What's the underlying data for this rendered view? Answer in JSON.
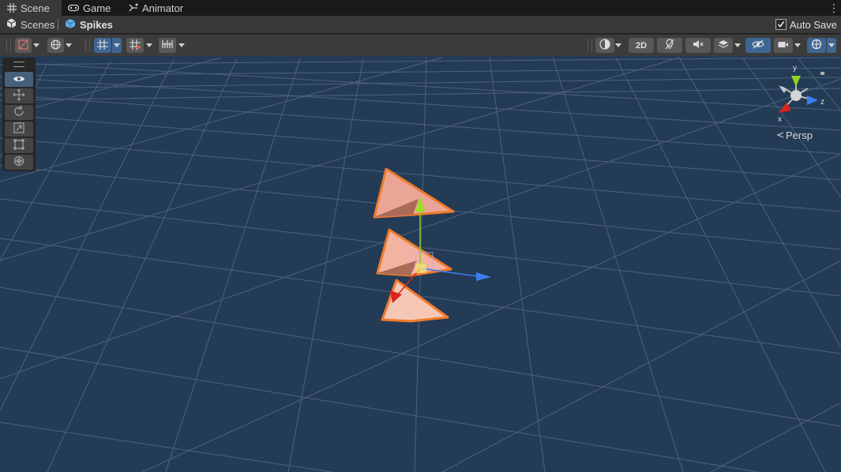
{
  "tabs": [
    {
      "label": "Scene",
      "icon": "grid-icon",
      "active": true
    },
    {
      "label": "Game",
      "icon": "gamepad-icon",
      "active": false
    },
    {
      "label": "Animator",
      "icon": "animator-icon",
      "active": false
    }
  ],
  "breadcrumb": {
    "root": "Scenes",
    "current": "Spikes"
  },
  "autosave": {
    "label": "Auto Save",
    "checked": true
  },
  "toolbar": {
    "mode_2d": "2D"
  },
  "gizmo": {
    "axis_x": "x",
    "axis_y": "y",
    "axis_z": "z",
    "projection": "Persp"
  },
  "colors": {
    "viewport": "#243b56",
    "selection": "#f07a2a",
    "x_axis": "#d8261e",
    "y_axis": "#8cd21e",
    "z_axis": "#3b7ef0",
    "active_tool": "#46607c"
  },
  "scene_tools": [
    "view-hand-icon",
    "move-icon",
    "rotate-icon",
    "scale-icon",
    "rect-icon",
    "transform-icon"
  ]
}
